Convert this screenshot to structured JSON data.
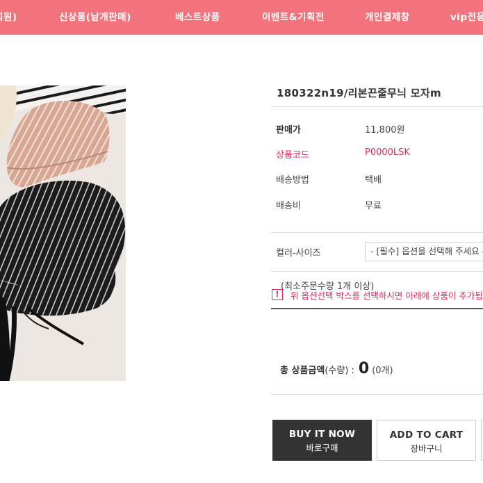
{
  "nav": {
    "items": [
      {
        "label": "회원)"
      },
      {
        "label": "신상품(낱개판매)"
      },
      {
        "label": "베스트상품"
      },
      {
        "label": "이벤트&기획전"
      },
      {
        "label": "개인결제창"
      },
      {
        "label": "vip전용"
      }
    ]
  },
  "colors": {
    "nav_bg": "#f2737b",
    "accent_pink": "#e3285a",
    "buy_button_bg": "#333333"
  },
  "product": {
    "title": "180322n19/리본끈줄무늬 모자m",
    "specs": [
      {
        "label": "판매가",
        "value": "11,800원"
      },
      {
        "label": "상품코드",
        "value": "P0000LSK"
      },
      {
        "label": "배송방법",
        "value": "택배"
      },
      {
        "label": "배송비",
        "value": "무료"
      }
    ],
    "option_label": "컬러-사이즈",
    "option_selected": "- [필수] 옵션을 선택해 주세요 -",
    "min_qty": "(최소주문수량 1개 이상)",
    "notice_icon": "!",
    "notice_text": "위 옵션선택 박스를 선택하시면 아래에 상품이 추가됩니다."
  },
  "total": {
    "label": "총 상품금액",
    "qty_label": "(수량) :",
    "value": "0",
    "count": "(0개)"
  },
  "buttons": {
    "buy_en": "BUY IT NOW",
    "buy_ko": "바로구매",
    "cart_en": "ADD TO CART",
    "cart_ko": "장바구니"
  }
}
